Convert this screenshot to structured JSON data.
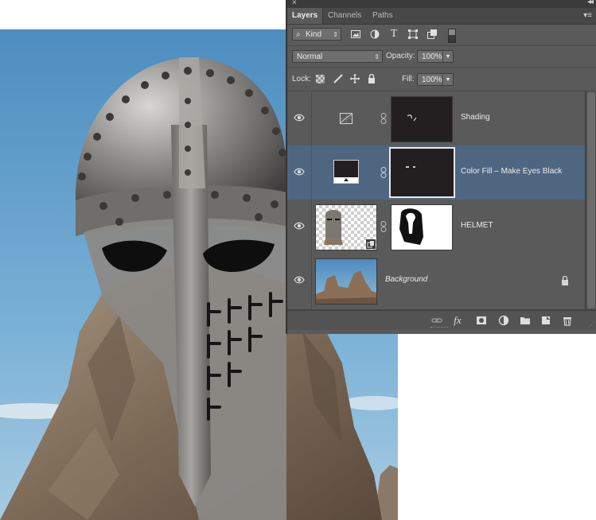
{
  "panel": {
    "close_glyph": "×",
    "collapse_glyph": "◂◂",
    "menu_glyph": "▾≡",
    "tabs": [
      {
        "label": "Layers",
        "active": true
      },
      {
        "label": "Channels",
        "active": false
      },
      {
        "label": "Paths",
        "active": false
      }
    ],
    "filter": {
      "search_glyph": "⌕",
      "value": "Kind"
    },
    "filter_icons": [
      "pixel-filter-icon",
      "adjustment-filter-icon",
      "type-filter-icon",
      "shape-filter-icon",
      "smart-object-filter-icon"
    ],
    "blend_mode": "Normal",
    "opacity_label": "Opacity:",
    "opacity_value": "100%",
    "lock_label": "Lock:",
    "fill_label": "Fill:",
    "fill_value": "100%",
    "type_glyph": "T",
    "layers": [
      {
        "name": "Shading",
        "kind": "adjustment",
        "selected": false,
        "italic": false
      },
      {
        "name": "Color Fill – Make Eyes Black",
        "kind": "fill",
        "selected": true,
        "italic": false
      },
      {
        "name": "HELMET",
        "kind": "smart-object",
        "selected": false,
        "italic": false
      },
      {
        "name": "Background",
        "kind": "background",
        "selected": false,
        "italic": true,
        "locked": true
      }
    ],
    "bottom_icons": [
      "link-layers-icon",
      "fx-icon",
      "add-mask-icon",
      "new-adjustment-icon",
      "new-group-icon",
      "new-layer-icon",
      "trash-icon"
    ],
    "fx_label": "fx",
    "colors": {
      "panel": "#5a5a5a",
      "selected": "#4f6680",
      "sky": "#6aa2c9"
    }
  }
}
